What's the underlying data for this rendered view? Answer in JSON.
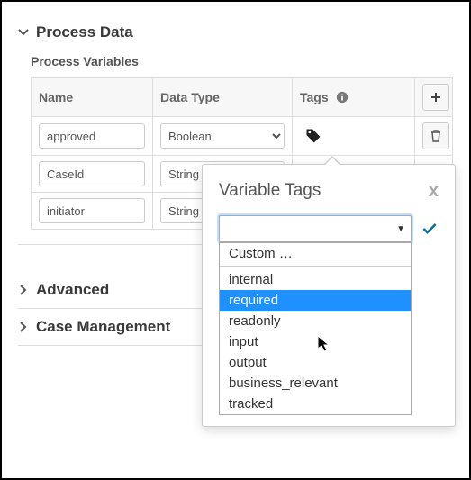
{
  "sections": {
    "process_data": {
      "title": "Process Data",
      "expanded": true
    },
    "advanced": {
      "title": "Advanced",
      "expanded": false
    },
    "case_mgmt": {
      "title": "Case Management",
      "expanded": false
    }
  },
  "process_vars": {
    "subtitle": "Process Variables",
    "headers": {
      "name": "Name",
      "data_type": "Data Type",
      "tags": "Tags"
    },
    "rows": [
      {
        "name": "approved",
        "type": "Boolean"
      },
      {
        "name": "CaseId",
        "type": "String"
      },
      {
        "name": "initiator",
        "type": "String"
      }
    ]
  },
  "popover": {
    "title": "Variable Tags",
    "close_label": "x",
    "options": [
      "Custom …",
      "internal",
      "required",
      "readonly",
      "input",
      "output",
      "business_relevant",
      "tracked"
    ],
    "selected_index": 2
  }
}
